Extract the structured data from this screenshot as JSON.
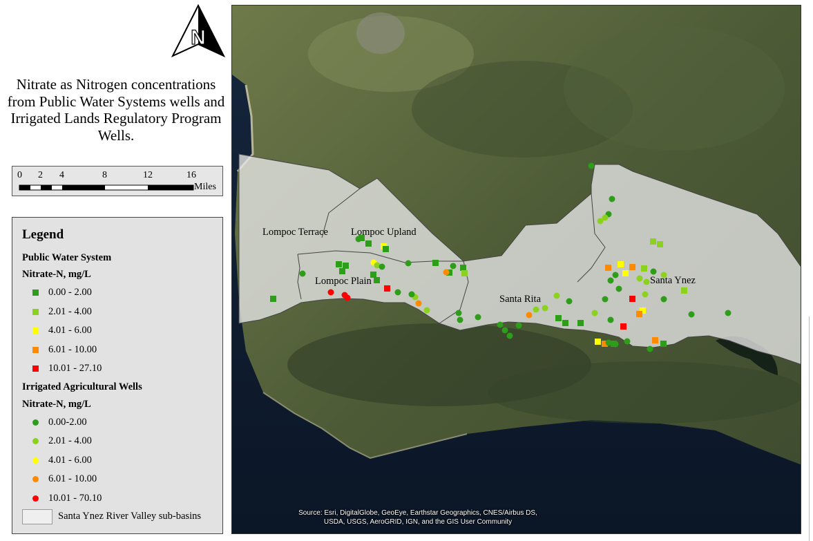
{
  "title": "Nitrate as Nitrogen concentrations from Public Water Systems wells and Irrigated Lands Regulatory Program Wells.",
  "north_arrow": {
    "label": "N",
    "icon": "north-arrow-icon"
  },
  "scale_bar": {
    "ticks": [
      "0",
      "2",
      "4",
      "8",
      "12",
      "16"
    ],
    "unit": "Miles"
  },
  "legend": {
    "heading": "Legend",
    "pws": {
      "title": "Public Water System",
      "subtitle": "Nitrate-N, mg/L",
      "classes": [
        {
          "label": "0.00 - 2.00",
          "color": "#2e9e1a"
        },
        {
          "label": "2.01 - 4.00",
          "color": "#8cd11e"
        },
        {
          "label": "4.01 - 6.00",
          "color": "#ffff00"
        },
        {
          "label": "6.01 - 10.00",
          "color": "#ff8a00"
        },
        {
          "label": "10.01 - 27.10",
          "color": "#ff0000"
        }
      ]
    },
    "ilrp": {
      "title": "Irrigated Agricultural Wells",
      "subtitle": "Nitrate-N, mg/L",
      "classes": [
        {
          "label": "0.00-2.00",
          "color": "#2e9e1a"
        },
        {
          "label": "2.01 - 4.00",
          "color": "#8cd11e"
        },
        {
          "label": "4.01 - 6.00",
          "color": "#ffff00"
        },
        {
          "label": "6.01 - 10.00",
          "color": "#ff8a00"
        },
        {
          "label": "10.01 - 70.10",
          "color": "#ff0000"
        }
      ]
    },
    "basins_label": "Santa Ynez River Valley sub-basins"
  },
  "subbasins": [
    "Lompoc Terrace",
    "Lompoc Upland",
    "Lompoc Plain",
    "Santa Rita",
    "Santa Ynez"
  ],
  "attribution": {
    "line1": "Source: Esri, DigitalGlobe, GeoEye, Earthstar Geographics, CNES/Airbus DS,",
    "line2": "USDA, USGS, AeroGRID, IGN, and the GIS User Community"
  }
}
